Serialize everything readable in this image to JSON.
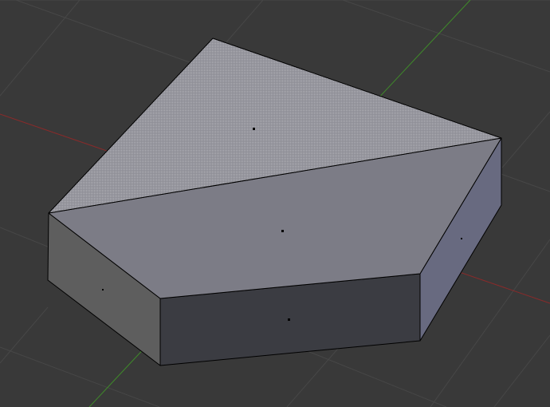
{
  "viewport": {
    "background": "#393939",
    "grid_color": "#464646",
    "x_axis_color": "#8a2a2a",
    "y_axis_color": "#3f8a2a",
    "selected_face_color": "#9c9ca4",
    "top_face_color": "#7c7c86",
    "front_face_color": "#3b3c42",
    "left_face_color": "#5e5e5e",
    "right_face_color": "#686a80",
    "edge_color": "#000000"
  }
}
